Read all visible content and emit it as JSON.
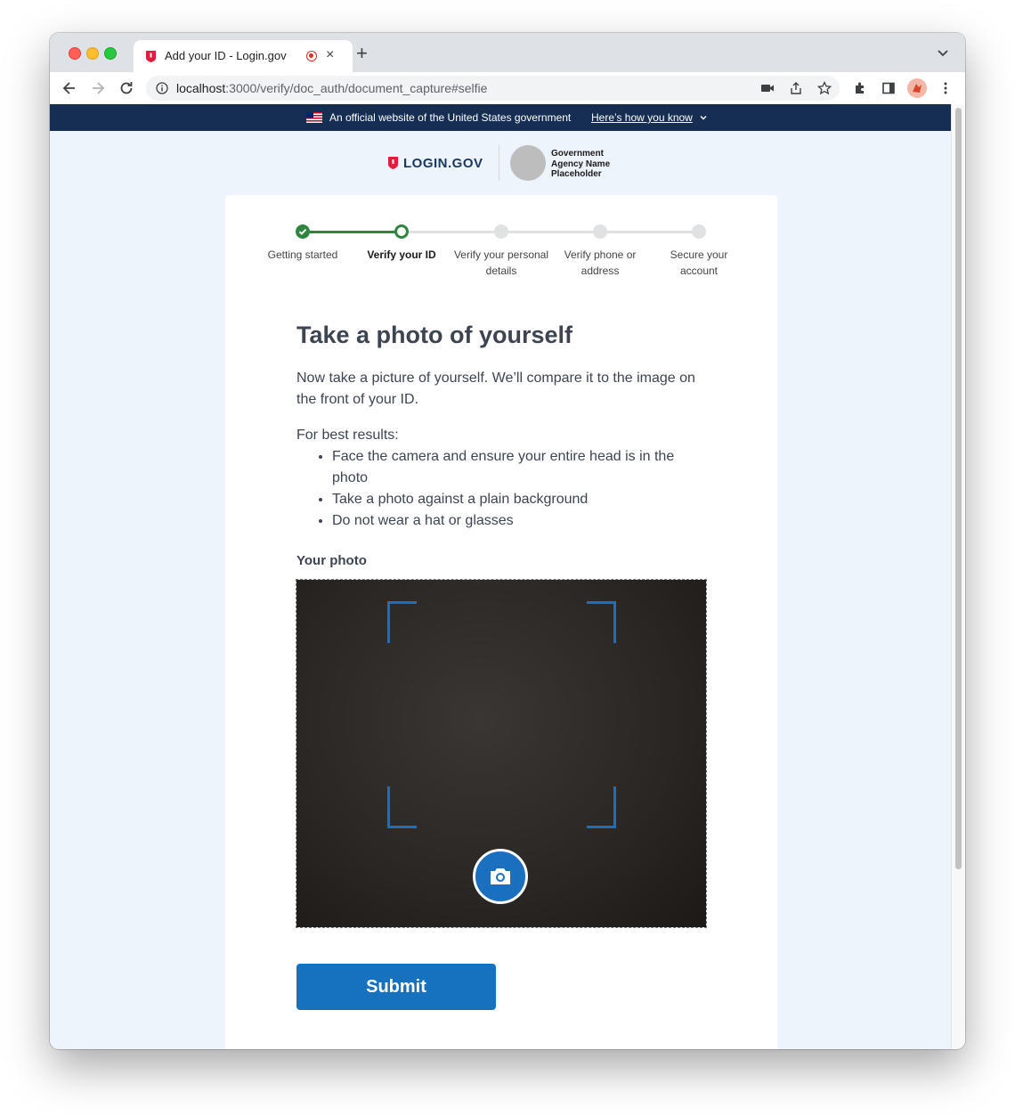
{
  "browser": {
    "tab_title": "Add your ID - Login.gov",
    "tab_close": "×",
    "new_tab": "+",
    "url_host": "localhost",
    "url_path": ":3000/verify/doc_auth/document_capture#selfie"
  },
  "gov_banner": {
    "text": "An official website of the United States government",
    "link": "Here’s how you know"
  },
  "header": {
    "brand": "LOGIN.GOV",
    "agency_name": "Government Agency Name Placeholder"
  },
  "steps": [
    {
      "label": "Getting started",
      "status": "complete"
    },
    {
      "label": "Verify your ID",
      "status": "current"
    },
    {
      "label": "Verify your personal details",
      "status": "pending"
    },
    {
      "label": "Verify phone or address",
      "status": "pending"
    },
    {
      "label": "Secure your account",
      "status": "pending"
    }
  ],
  "main": {
    "heading": "Take a photo of yourself",
    "intro": "Now take a picture of yourself. We’ll compare it to the image on the front of your ID.",
    "best_results": "For best results:",
    "tips": [
      "Face the camera and ensure your entire head is in the photo",
      "Take a photo against a plain background",
      "Do not wear a hat or glasses"
    ],
    "photo_label": "Your photo",
    "submit": "Submit"
  },
  "colors": {
    "primary": "#1672bf",
    "success": "#2e8540",
    "banner": "#162e51",
    "page_bg": "#eef4fb"
  }
}
